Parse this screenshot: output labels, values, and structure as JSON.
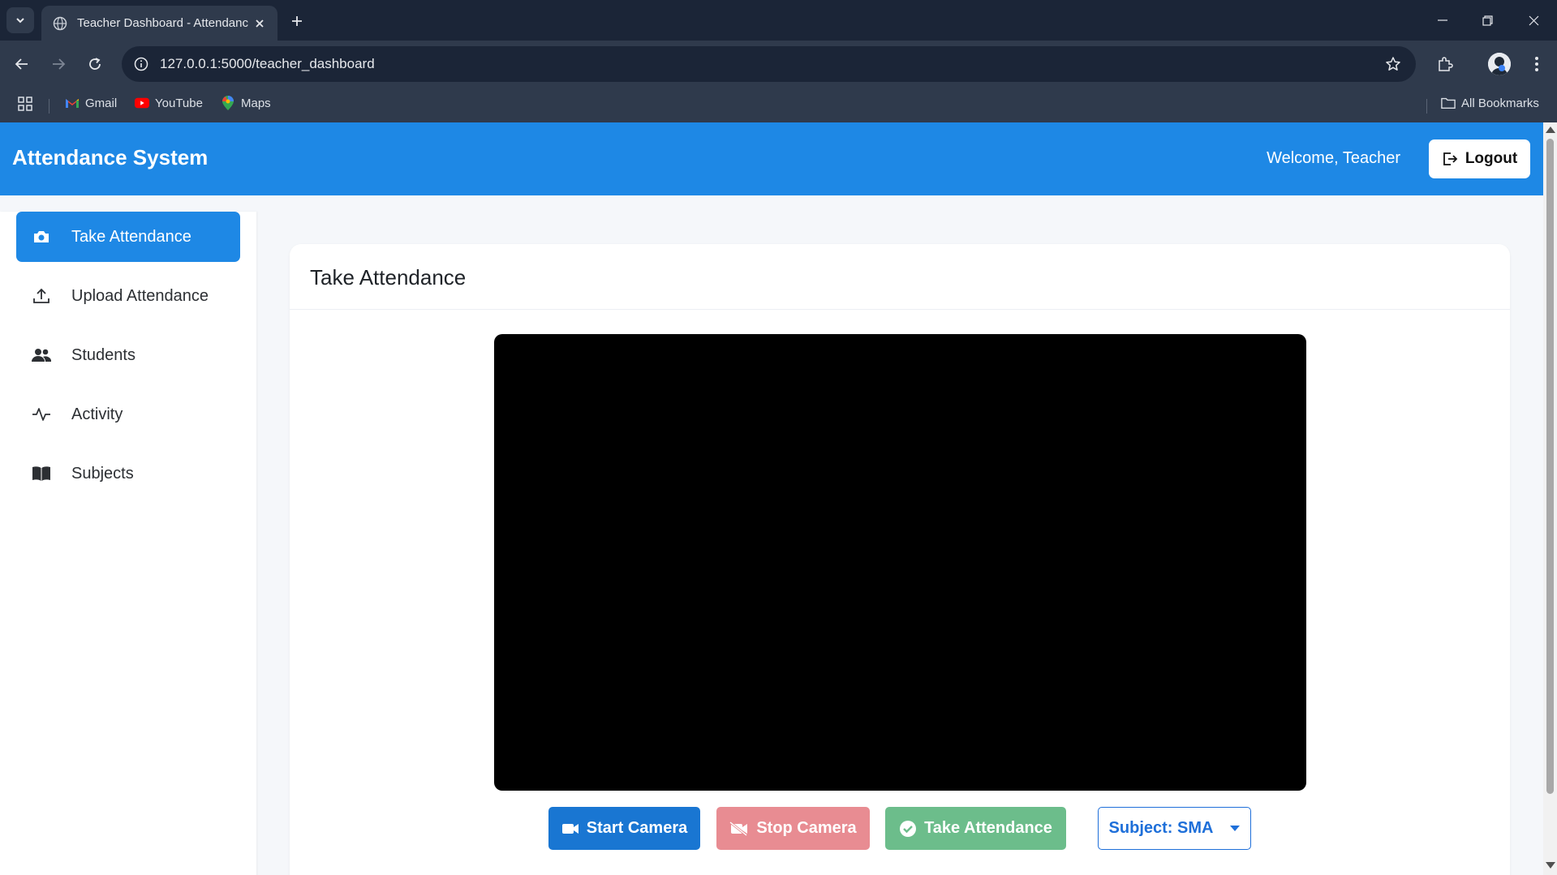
{
  "browser": {
    "tab_title": "Teacher Dashboard - Attendanc",
    "url": "127.0.0.1:5000/teacher_dashboard",
    "bookmarks": [
      {
        "label": "Gmail",
        "icon": "gmail-icon"
      },
      {
        "label": "YouTube",
        "icon": "youtube-icon"
      },
      {
        "label": "Maps",
        "icon": "maps-icon"
      }
    ],
    "all_bookmarks_label": "All Bookmarks"
  },
  "navbar": {
    "brand": "Attendance System",
    "welcome": "Welcome, Teacher",
    "logout_label": "Logout"
  },
  "sidebar": {
    "items": [
      {
        "label": "Take Attendance",
        "icon": "camera-icon",
        "active": true
      },
      {
        "label": "Upload Attendance",
        "icon": "upload-icon",
        "active": false
      },
      {
        "label": "Students",
        "icon": "users-icon",
        "active": false
      },
      {
        "label": "Activity",
        "icon": "activity-icon",
        "active": false
      },
      {
        "label": "Subjects",
        "icon": "book-icon",
        "active": false
      }
    ]
  },
  "main": {
    "card_title": "Take Attendance",
    "buttons": {
      "start_camera": "Start Camera",
      "stop_camera": "Stop Camera",
      "take_attendance": "Take Attendance",
      "subject": "Subject: SMA"
    }
  },
  "colors": {
    "primary": "#1e88e5",
    "start": "#1976d2",
    "stop": "#e88c92",
    "take": "#6cbd8b",
    "chrome_dark": "#1b2537",
    "chrome": "#2f3a4c"
  }
}
